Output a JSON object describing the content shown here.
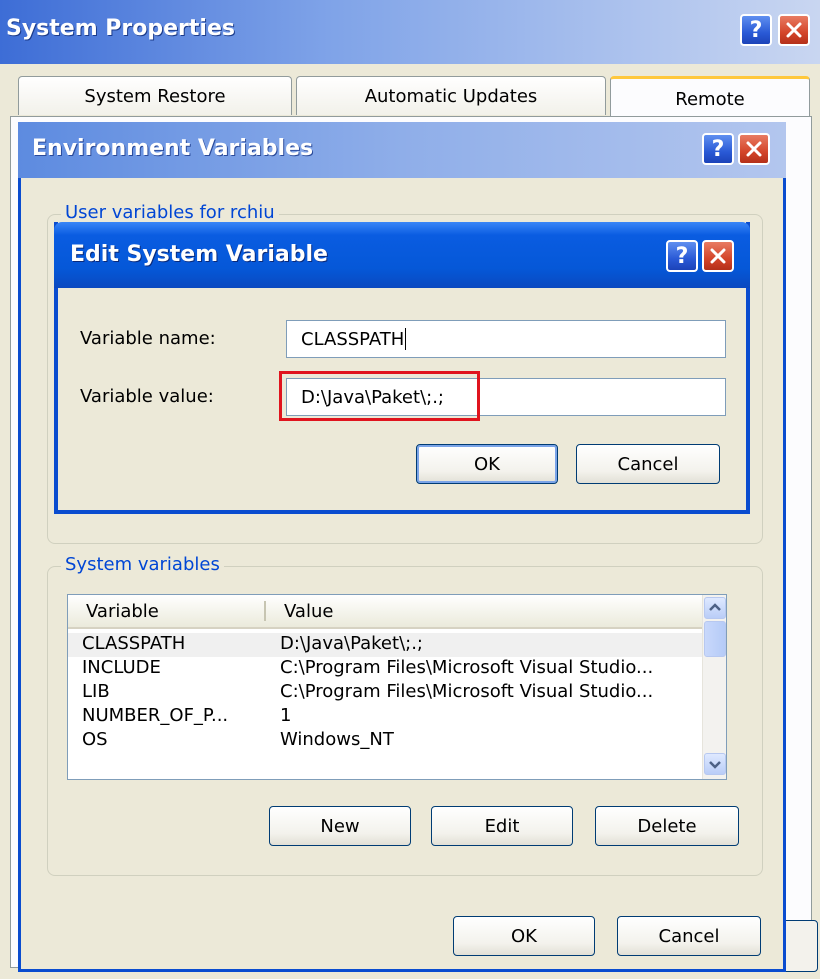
{
  "system_properties": {
    "title": "System Properties",
    "tabs": [
      "System Restore",
      "Automatic Updates",
      "Remote"
    ]
  },
  "environment_variables": {
    "title": "Environment Variables",
    "hidden_group_label": "User variables for rchiu",
    "system_group_label": "System variables",
    "columns": [
      "Variable",
      "Value"
    ],
    "rows": [
      {
        "variable": "CLASSPATH",
        "value": "D:\\Java\\Paket\\;.;"
      },
      {
        "variable": "INCLUDE",
        "value": "C:\\Program Files\\Microsoft Visual Studio..."
      },
      {
        "variable": "LIB",
        "value": "C:\\Program Files\\Microsoft Visual Studio..."
      },
      {
        "variable": "NUMBER_OF_P...",
        "value": "1"
      },
      {
        "variable": "OS",
        "value": "Windows_NT"
      }
    ],
    "buttons": {
      "new": "New",
      "edit": "Edit",
      "delete": "Delete",
      "ok": "OK",
      "cancel": "Cancel"
    }
  },
  "edit_dialog": {
    "title": "Edit System Variable",
    "name_label": "Variable name:",
    "name_value": "CLASSPATH",
    "value_label": "Variable value:",
    "value_value": "D:\\Java\\Paket\\;.;",
    "ok": "OK",
    "cancel": "Cancel"
  },
  "colors": {
    "titlebar_blue": "#0a5ce1",
    "dialog_face": "#ece9d8",
    "highlight_box": "#e0141e",
    "group_label_blue": "#0046d5"
  },
  "icons": [
    "help-icon",
    "close-icon",
    "scroll-up-icon",
    "scroll-down-icon"
  ]
}
